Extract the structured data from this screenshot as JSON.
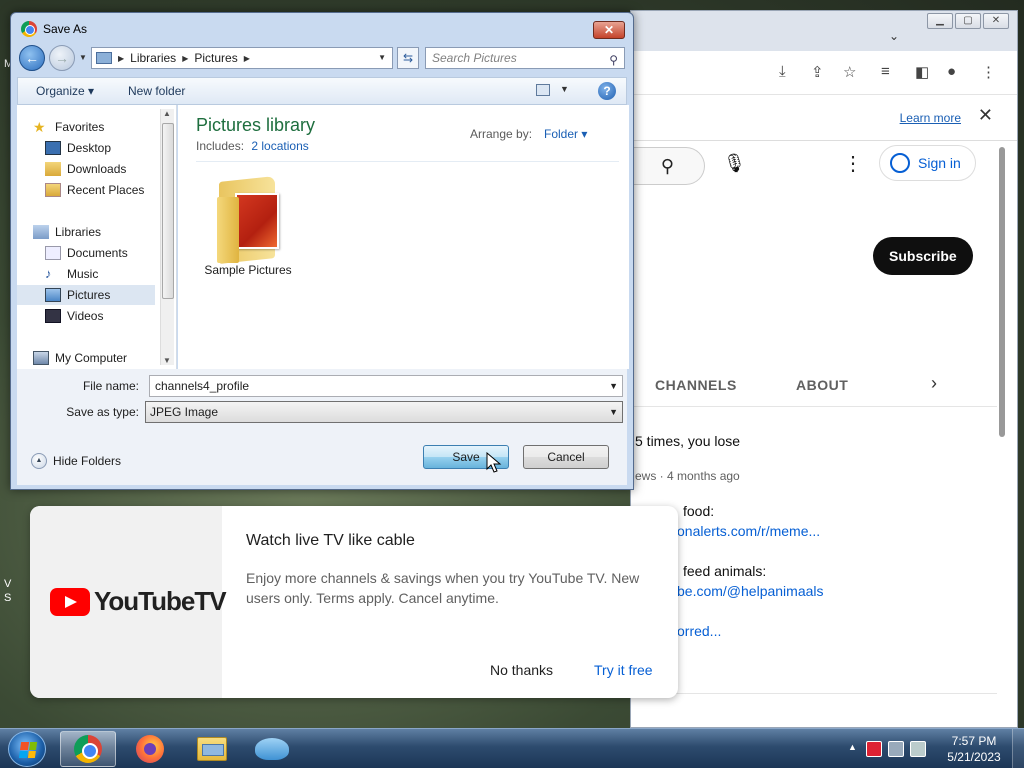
{
  "desktop": {
    "labels": [
      "M",
      "V",
      "S"
    ]
  },
  "chrome": {
    "learn_more": "Learn more",
    "sign_in": "Sign in",
    "subscribe": "Subscribe",
    "tabs": [
      "CHANNELS",
      "ABOUT"
    ],
    "post_title": "5 times, you lose",
    "post_meta": "ews · 4 months ago",
    "line1_text": "food:",
    "line1_link": "onalerts.com/r/meme...",
    "line2_text": "feed animals:",
    "line2_link": "be.com/@helpanimaals",
    "line3_link": "orred..."
  },
  "promo": {
    "logo_text": "YouTubeTV",
    "title": "Watch live TV like cable",
    "body": "Enjoy more channels & savings when you try YouTube TV. New users only. Terms apply. Cancel anytime.",
    "no_thanks": "No thanks",
    "try_free": "Try it free"
  },
  "dialog": {
    "title": "Save As",
    "close": "✕",
    "breadcrumb": [
      "Libraries",
      "Pictures"
    ],
    "search_placeholder": "Search Pictures",
    "organize": "Organize",
    "new_folder": "New folder",
    "help": "?",
    "nav": {
      "favorites": "Favorites",
      "desktop": "Desktop",
      "downloads": "Downloads",
      "recent_places": "Recent Places",
      "libraries": "Libraries",
      "documents": "Documents",
      "music": "Music",
      "pictures": "Pictures",
      "videos": "Videos",
      "my_computer": "My Computer"
    },
    "library_title": "Pictures library",
    "includes_label": "Includes:",
    "includes_link": "2 locations",
    "arrange_label": "Arrange by:",
    "arrange_value": "Folder",
    "folder_name": "Sample Pictures",
    "file_name_label": "File name:",
    "file_name_value": "channels4_profile",
    "save_type_label": "Save as type:",
    "save_type_value": "JPEG Image",
    "hide_folders": "Hide Folders",
    "save": "Save",
    "cancel": "Cancel"
  },
  "taskbar": {
    "time": "7:57 PM",
    "date": "5/21/2023"
  }
}
